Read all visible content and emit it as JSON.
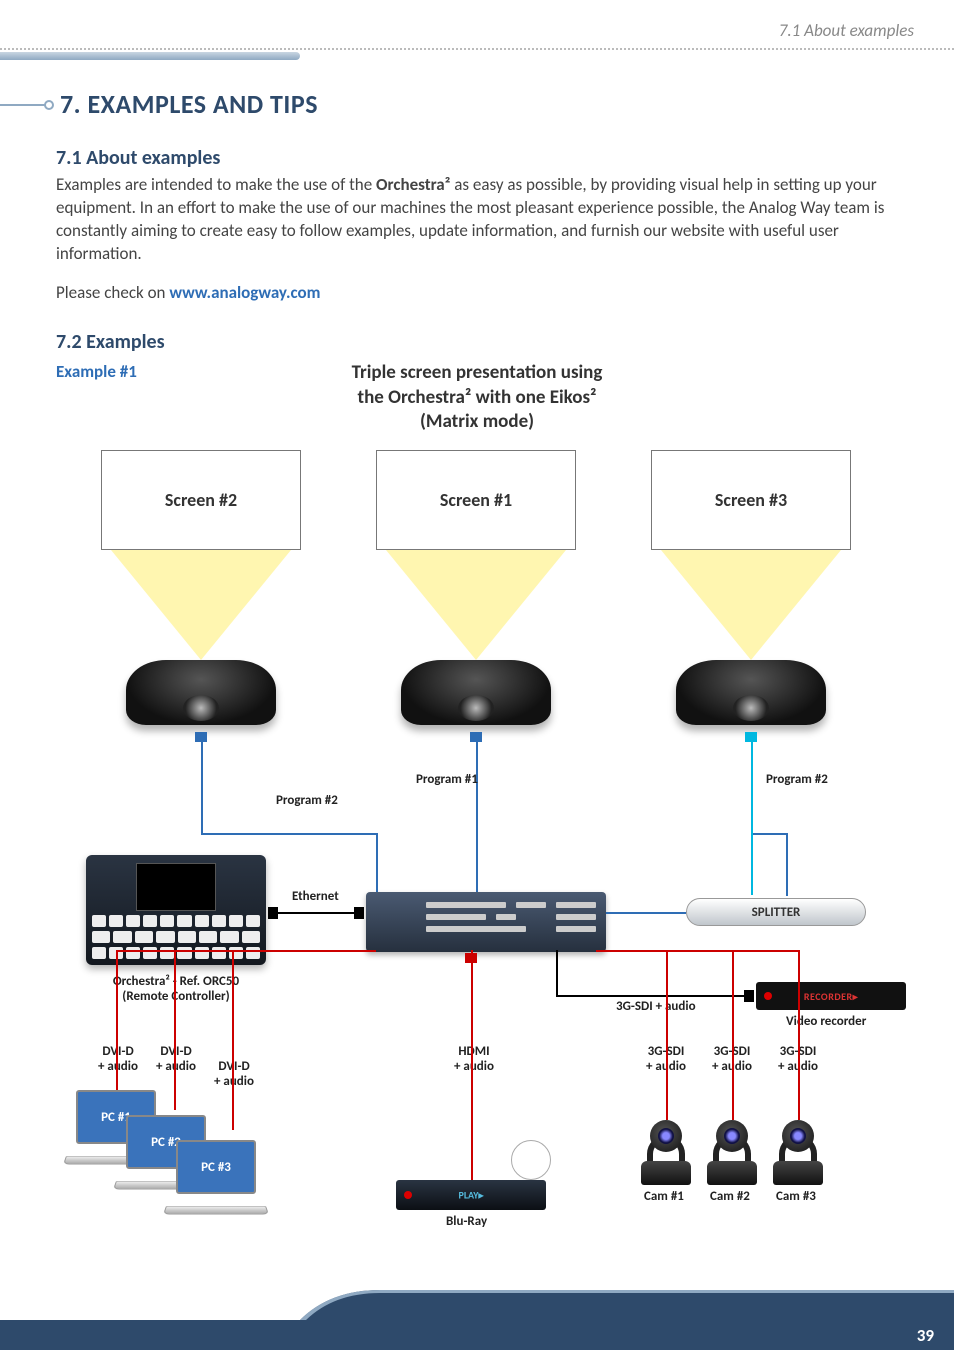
{
  "header": {
    "breadcrumb": "7.1 About examples"
  },
  "chapter": "7. EXAMPLES AND TIPS",
  "s71": {
    "title": "7.1 About examples",
    "para_pre": "Examples are intended to make the use of the ",
    "para_bold": "Orchestra²",
    "para_post": " as easy as possible, by providing visual help in setting up your equipment. In an effort to make the use of our machines the most pleasant experience possible, the Analog Way team is constantly aiming to create easy to follow examples, update information, and furnish our website with useful user information.",
    "check_pre": "Please check on ",
    "check_link": "www.analogway.com"
  },
  "s72": {
    "title": "7.2 Examples",
    "example_label": "Example #1",
    "diagram_title_l1": "Triple screen presentation using",
    "diagram_title_l2": "the Orchestra² with one Eikos²",
    "diagram_title_l3": "(Matrix mode)"
  },
  "diagram": {
    "screen2": "Screen #2",
    "screen1": "Screen #1",
    "screen3": "Screen #3",
    "program1": "Program #1",
    "program2_left": "Program #2",
    "program2_right": "Program #2",
    "ethernet": "Ethernet",
    "splitter": "SPLITTER",
    "sdi_plus_audio": "3G-SDI + audio",
    "video_recorder": "Video recorder",
    "orchestra_l1": "Orchestra² - Ref. ORC50",
    "orchestra_l2": "(Remote Controller)",
    "dvi_d": "DVI-D",
    "plus_audio": "+ audio",
    "hdmi": "HDMI",
    "sg_sdi": "3G-SDI",
    "pc1": "PC #1",
    "pc2": "PC #2",
    "pc3": "PC #3",
    "bluray": "Blu-Ray",
    "bluray_inner": "PLAY▸",
    "cam1": "Cam #1",
    "cam2": "Cam #2",
    "cam3": "Cam #3",
    "recorder_inner": "RECORDER▸"
  },
  "footer": {
    "page": "39"
  }
}
